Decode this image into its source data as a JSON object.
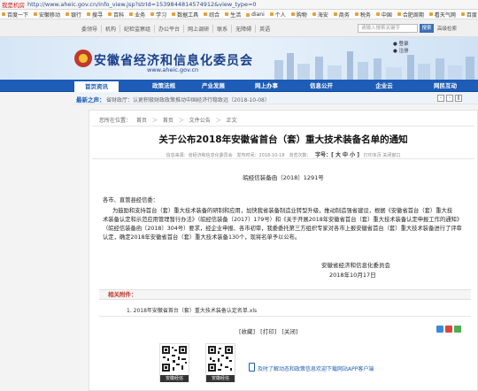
{
  "browser": {
    "site_tag": "我是机房",
    "url": "http://www.aheic.gov.cn/info_view.jsp?strId=1539844814574912&view_type=0",
    "bookmarks": [
      "百度一下",
      "安徽移动",
      "银行",
      "搜寻",
      "百科",
      "业务",
      "学习",
      "数据工具",
      "综合",
      "生活",
      "diani",
      "个人",
      "购物",
      "海安",
      "商务",
      "税务",
      "中国",
      "合肥周期",
      "看天气网",
      "百度"
    ]
  },
  "site": {
    "util_links": [
      "委领导",
      "机构",
      "纪检监察组",
      "办公平台",
      "网上调研",
      "联系",
      "无障碍",
      "英语"
    ],
    "search_placeholder": "请输入搜索关键字",
    "search_button": "搜索",
    "advanced": "高级检索",
    "title": "安徽省经济和信息化委员会",
    "domain": "www.aheic.gov.cn",
    "login_lines": [
      "● 登录",
      "● 注册"
    ],
    "nav": [
      "首页资讯",
      "政策法规",
      "产业发展",
      "网上办事",
      "信息公开",
      "企业云",
      "网民互动"
    ],
    "notice_label": "最新之声：",
    "notice_text": "省财政厅：认更积极财政政策推动中国经济行稳致远（2018-10-08）",
    "notice_controls": [
      "‹",
      "›",
      "ǁ"
    ]
  },
  "article": {
    "breadcrumb": [
      "您所在位置：",
      "首页",
      "＞",
      "首页",
      "＞",
      "文件公告",
      "＞",
      "正文"
    ],
    "title": "关于公布2018年安徽省首台（套）重大技术装备名单的通知",
    "meta_source": "信息来源：省经济和信息化委员会",
    "meta_date": "发布时间：2018-10-18",
    "meta_views": "浏览次数：",
    "font_size": "字号：[ 大 中 小 ]",
    "meta_print": "打印本页  关闭窗口",
    "doc_number": "皖经信装备函〔2018〕1291号",
    "greeting": "各市、直管县经信委：",
    "paragraph": [
      "为鼓励和支持首台（套）重大技术装备的研制和应用，加快我省装备制造业转型升级，推动制造强省建设，根据《安徽省首台（套）重大技",
      "术装备认定和示范应用管理暂行办法》（皖经信装备〔2017〕179号）和《关于开展2018年安徽省首台（套）重大技术装备认定申报工作的通知》",
      "（皖经信装备函〔2018〕304号）要求，经企业申报、各市初审，我委委托第三方组织专家对各市上报安徽省首台（套）重大技术装备进行了评审",
      "认定，确定2018年安徽省首台（套）重大技术装备130个，现将名单予以公布。"
    ],
    "signature": "安徽省经济和信息化委员会",
    "sign_date": "2018年10月17日",
    "attachments_label": "相关附件：",
    "attachment_item": "1.   2018年安徽省首台（套）重大技术装备认定名单.xls",
    "actions": [
      "[收藏]",
      "[打印]",
      "[关闭]"
    ],
    "qr_captions": [
      "安徽经信",
      "安徽经信"
    ],
    "app_message": "及时了解动态和政策信息欢迎下载网站APP客户端"
  },
  "colors": {
    "nav_blue": "#1d5cb7",
    "title_blue": "#1a3f8c",
    "attachment_red": "#c0392b"
  },
  "icons": [
    "emblem-icon",
    "search-icon",
    "share-icons",
    "qr-code-icon",
    "phone-icon"
  ]
}
